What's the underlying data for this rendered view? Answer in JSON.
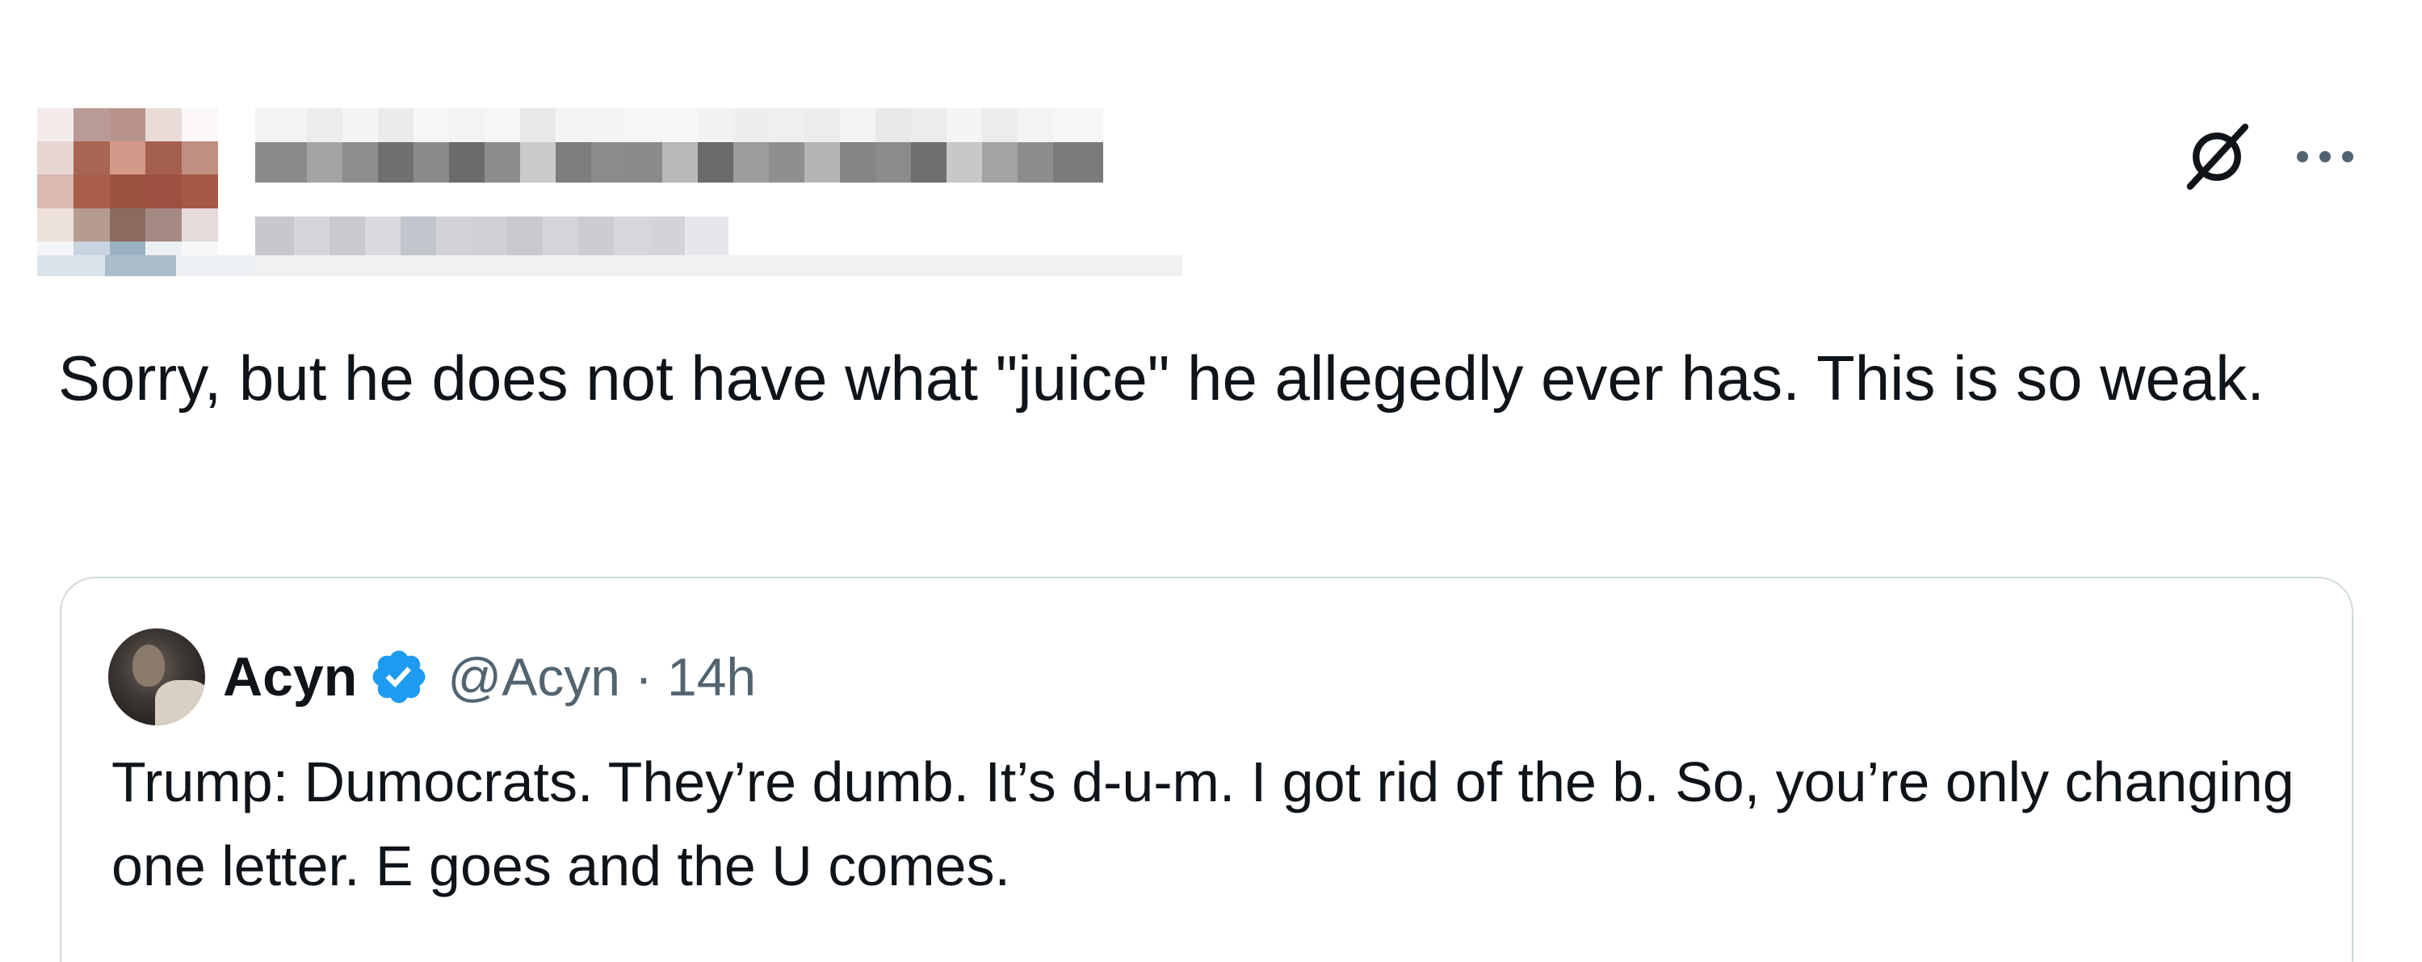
{
  "author": {
    "name": "",
    "handle": ""
  },
  "header": {
    "grok_icon": "grok-icon",
    "more_icon": "more-icon"
  },
  "post": {
    "text": "Sorry, but he does not have what \"juice\" he allegedly ever has. This is so weak."
  },
  "quoted_post": {
    "name": "Acyn",
    "handle": "@Acyn",
    "separator": "·",
    "time": "14h",
    "verified_icon": "verified-badge-icon",
    "text": "Trump: Dumocrats. They’re dumb. It’s d-u-m. I got rid of the b. So, you’re only changing one letter. E goes and the U comes."
  },
  "colors": {
    "text_primary": "#0f1419",
    "text_secondary": "#536471",
    "border": "#cfd9de",
    "verified_blue": "#1d9bf0"
  }
}
